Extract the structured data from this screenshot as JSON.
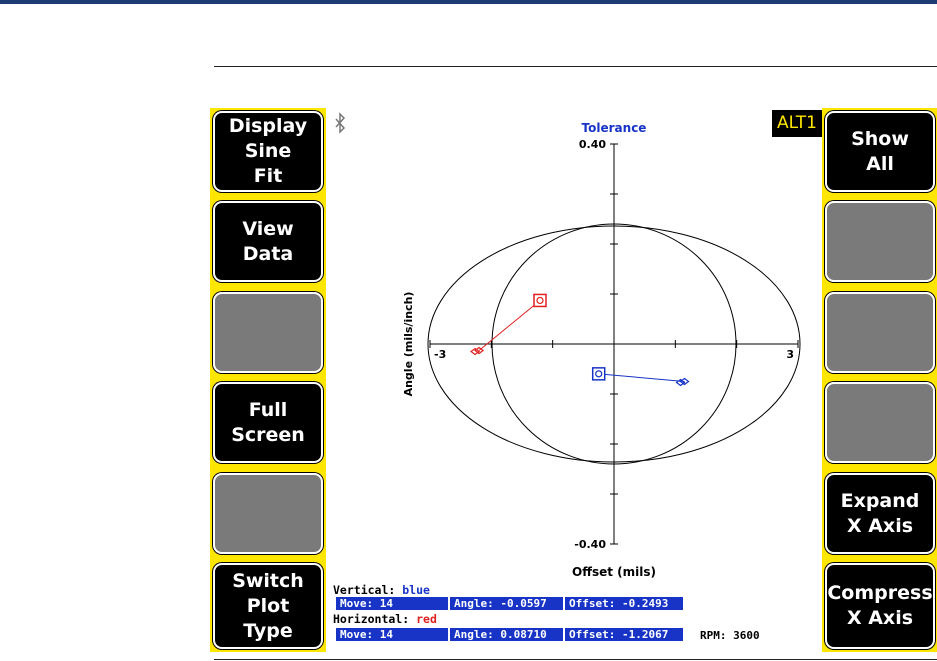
{
  "buttons_left": [
    {
      "label": "Display\nSine\nFit",
      "style": "dark"
    },
    {
      "label": "View\nData",
      "style": "dark"
    },
    {
      "label": "",
      "style": "gray"
    },
    {
      "label": "Full\nScreen",
      "style": "dark"
    },
    {
      "label": "",
      "style": "gray"
    },
    {
      "label": "Switch\nPlot\nType",
      "style": "dark"
    }
  ],
  "buttons_right": [
    {
      "label": "Show\nAll",
      "style": "dark"
    },
    {
      "label": "",
      "style": "gray"
    },
    {
      "label": "",
      "style": "gray"
    },
    {
      "label": "",
      "style": "gray"
    },
    {
      "label": "Expand\nX Axis",
      "style": "dark"
    },
    {
      "label": "Compress\nX Axis",
      "style": "dark"
    }
  ],
  "alt_badge": "ALT1",
  "status_icon": "bluetooth-icon",
  "chart_data": {
    "type": "scatter",
    "title": "Tolerance",
    "xlabel": "Offset (mils)",
    "ylabel": "Angle (mils/inch)",
    "xlim": [
      -3,
      3
    ],
    "ylim": [
      -0.4,
      0.4
    ],
    "x_tick_labels": [
      "-3",
      "3"
    ],
    "y_tick_labels": [
      "0.40",
      "-0.40"
    ],
    "series": [
      {
        "name": "Vertical",
        "color": "#1734c7",
        "start": {
          "x": -0.2493,
          "y": -0.0597
        },
        "end": {
          "x": 1.15,
          "y": -0.075
        }
      },
      {
        "name": "Horizontal",
        "color": "#e02020",
        "start": {
          "x": -1.2067,
          "y": 0.0871
        },
        "end": {
          "x": -2.2,
          "y": -0.013
        }
      }
    ]
  },
  "readout": {
    "vertical_label": "Vertical:",
    "vertical_color": "blue",
    "horizontal_label": "Horizontal:",
    "horizontal_color": "red",
    "vertical_move": "Move: 14",
    "vertical_angle": "Angle: -0.0597",
    "vertical_offset": "Offset: -0.2493",
    "horizontal_move": "Move: 14",
    "horizontal_angle": "Angle: 0.08710",
    "horizontal_offset": "Offset: -1.2067",
    "rpm": "RPM:  3600"
  }
}
